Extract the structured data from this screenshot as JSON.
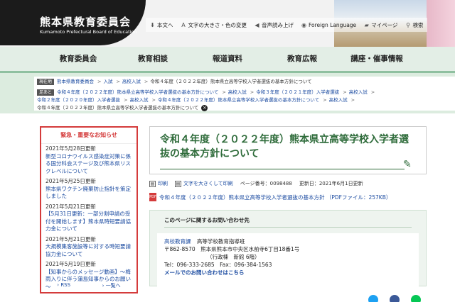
{
  "header": {
    "title": "熊本県教育委員会",
    "subtitle": "Kumamoto Prefectural Board of Education",
    "tools": [
      {
        "icon": "download-icon",
        "label": "本文へ"
      },
      {
        "icon": "text-size-icon",
        "label": "文字の大きさ・色の変更"
      },
      {
        "icon": "speaker-icon",
        "label": "音声読み上げ"
      },
      {
        "icon": "globe-icon",
        "label": "Foreign Language"
      },
      {
        "icon": "folder-icon",
        "label": "マイページ"
      },
      {
        "icon": "search-icon",
        "label": "検索"
      }
    ]
  },
  "nav": {
    "items": [
      "教育委員会",
      "教育相談",
      "報道資料",
      "教育広報",
      "講座・催事情報"
    ]
  },
  "breadcrumb": {
    "current_tag": "現在地",
    "current_path": [
      "熊本県教育委員会",
      "入試",
      "高校入試"
    ],
    "current_page": "令和４年度（２０２２年度）熊本県立高等学校入学者選抜の基本方針について",
    "history_tag": "足あと",
    "history_path": [
      "令和４年度（２０２２年度）熊本県立高等学校入学者選抜の基本方針について",
      "高校入試",
      "令和３年度（２０２１年度）入学者選抜",
      "高校入試",
      "令和２年度（２０２０年度）入学者選抜",
      "高校入試",
      "令和４年度（２０２２年度）熊本県立高等学校入学者選抜の基本方針について",
      "高校入試",
      "令和４年度（２０２２年度）熊本県立高等学校入学者選抜の基本方針について"
    ]
  },
  "sidebar": {
    "heading": "緊急・重要なお知らせ",
    "news": [
      {
        "date": "2021年5月28日更新",
        "title": "新型コロナウイルス感染症対策に係る国分科会ステージ及び熊本県リスクレベルについて"
      },
      {
        "date": "2021年5月25日更新",
        "title": "熊本県ワクチン廃棄防止指針を策定しました"
      },
      {
        "date": "2021年5月21日更新",
        "title": "【5月31日更新：一部分割申請の受付を開始します】熊本県時短要請協力金について"
      },
      {
        "date": "2021年5月21日更新",
        "title": "大規模集客施設等に対する時短要請協力金について"
      },
      {
        "date": "2021年5月19日更新",
        "title": "【知事からのメッセージ動画】～梅雨入りに伴う蒲島知事からのお願い～"
      }
    ],
    "rss_label": "RSS",
    "list_label": "一覧へ"
  },
  "main": {
    "title": "令和４年度（２０２２年度）熊本県立高等学校入学者選抜の基本方針について",
    "print_label": "印刷",
    "large_print_label": "文字を大きくして印刷",
    "page_id": "ページ番号：0098488",
    "updated": "更新日：2021年6月1日更新",
    "pdf_link": "令和４年度（２０２２年度）熊本県立高等学校入学者選抜の基本方針 （PDFファイル：257KB）",
    "contact_heading": "このページに関するお問い合わせ先",
    "contact_dept": "高校教育課",
    "contact_section": "高等学校教育指導班",
    "contact_address1": "〒862-8570　熊本県熊本市中央区水前寺6丁目18番1号",
    "contact_address2": "（行政棟　新館 6階）",
    "contact_phone": "Tel：096-333-2685　Fax：096-384-1563",
    "contact_mail": "メールでのお問い合わせはこちら"
  },
  "colors": {
    "accent_green": "#2e6b3a",
    "nav_bg": "#e3eee6",
    "alert_red": "#d43b3b",
    "link_blue": "#1a4aa0",
    "twitter": "#1da1f2",
    "facebook": "#3b5998",
    "line": "#06c755"
  }
}
